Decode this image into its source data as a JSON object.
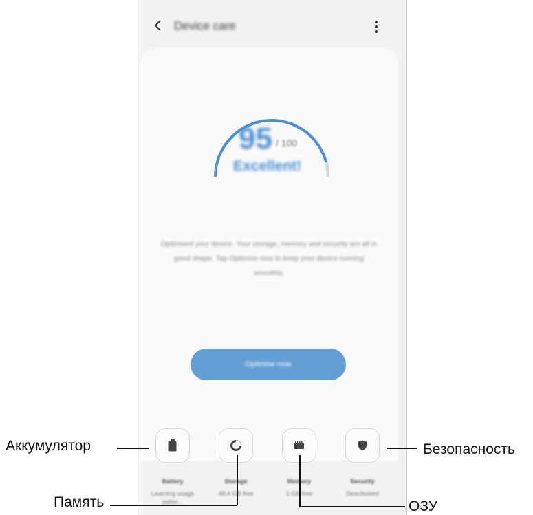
{
  "app_bar": {
    "title": "Device care"
  },
  "score": {
    "value": "95",
    "total": "/ 100",
    "status": "Excellent!"
  },
  "description": "Optimised your device. Your storage, memory and security are all in good shape. Tap Optimise now to keep your device running smoothly.",
  "optimize_button": {
    "label": "Optimise now"
  },
  "tiles": [
    {
      "label": "Battery",
      "value": "Learning usage patter...",
      "icon": "battery-icon"
    },
    {
      "label": "Storage",
      "value": "48.4 GB free",
      "icon": "storage-pie-icon"
    },
    {
      "label": "Memory",
      "value": "1 GB free",
      "icon": "memory-chip-icon"
    },
    {
      "label": "Security",
      "value": "Deactivated",
      "icon": "shield-icon"
    }
  ],
  "callouts": {
    "battery": "Аккумулятор",
    "storage": "Память",
    "memory": "ОЗУ",
    "security": "Безопасность"
  },
  "colors": {
    "accent": "#4b8fd2",
    "background": "#f2f2f2",
    "card": "#fafafa"
  }
}
